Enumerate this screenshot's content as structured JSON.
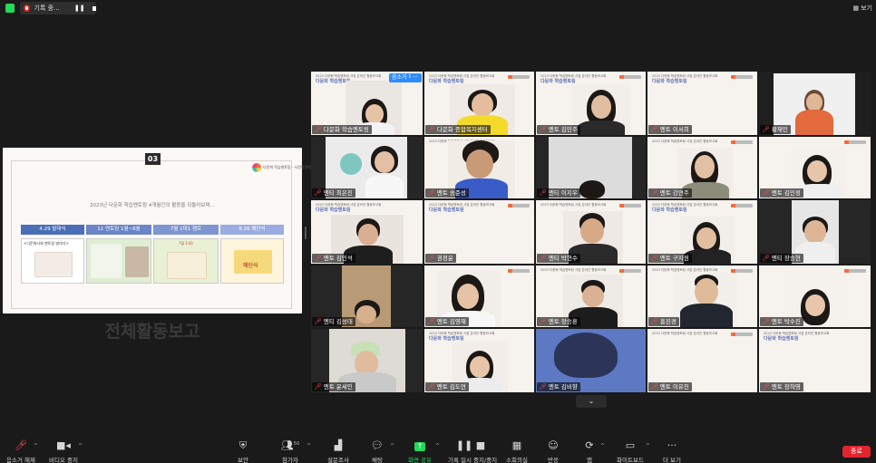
{
  "topbar": {
    "rec_label": "기록 중...",
    "pause_icon": "pause-icon",
    "stop_icon": "stop-icon",
    "view_label": "보기"
  },
  "slide": {
    "number": "03",
    "title": "전체활동보고",
    "subtitle": "2023년 다문화 학습멘토링 4개월간의 활동을 되돌아보며…",
    "logo_text": "다문화 학습멘토링 · 사랑의열매",
    "phases": [
      "4.29 발대식",
      "11 멘토링 1월~8월",
      "7월 1대1 캠프",
      "8.26 해단식"
    ],
    "thumb1_caption": "<다문화사회 멘토링 발대식>",
    "thumb3_caption": "7월 1대1",
    "thumb4_caption": "해단식"
  },
  "tile_header": {
    "line1": "2023 다문화 학습멘토링 사업 온라인 활동보고회",
    "line2": "다문화 학습멘토링"
  },
  "tiles": [
    {
      "name": "다문화 학습멘토링",
      "unmute_label": "음소거 해제",
      "more_label": "···"
    },
    {
      "name": "다문화 종합복지센터"
    },
    {
      "name": "멘토 김민주"
    },
    {
      "name": "멘토 이서희"
    },
    {
      "name": "황재민"
    },
    {
      "name": "멘티 최은진"
    },
    {
      "name": "멘토 송준성"
    },
    {
      "name": "멘티 이지우"
    },
    {
      "name": "멘토 강연주"
    },
    {
      "name": "멘토 김민정"
    },
    {
      "name": "멘토 김민석"
    },
    {
      "name": "권정윤"
    },
    {
      "name": "멘티 박현수"
    },
    {
      "name": "멘토 구지원"
    },
    {
      "name": "멘티 장승현"
    },
    {
      "name": "멘티 김성태"
    },
    {
      "name": "멘토 김영재"
    },
    {
      "name": "멘토 장승훈"
    },
    {
      "name": "홍진경"
    },
    {
      "name": "멘토 박수진"
    },
    {
      "name": "멘토 윤세인"
    },
    {
      "name": "멘토 김도연"
    },
    {
      "name": "멘토 김비향"
    },
    {
      "name": "멘토 이유진"
    },
    {
      "name": "멘토 장하영"
    }
  ],
  "toolbar": {
    "unmute": "음소거 해제",
    "video": "비디오 중지",
    "security": "보안",
    "participants": "참가자",
    "participants_count": "50",
    "poll": "설문조사",
    "chat": "채팅",
    "share": "화면 공유",
    "pause_record": "기록 일시 중지/중지",
    "breakout": "소회의실",
    "reactions": "반응",
    "apps": "앱",
    "whiteboard": "화이트보드",
    "more": "더 보기",
    "end": "종료"
  },
  "colors": {
    "toolbar_bg": "#1a1a1a",
    "active_speaker": "#c6e23a",
    "share_green": "#23d959",
    "end_red": "#e0252e",
    "muted_red": "#ff4a4a"
  }
}
